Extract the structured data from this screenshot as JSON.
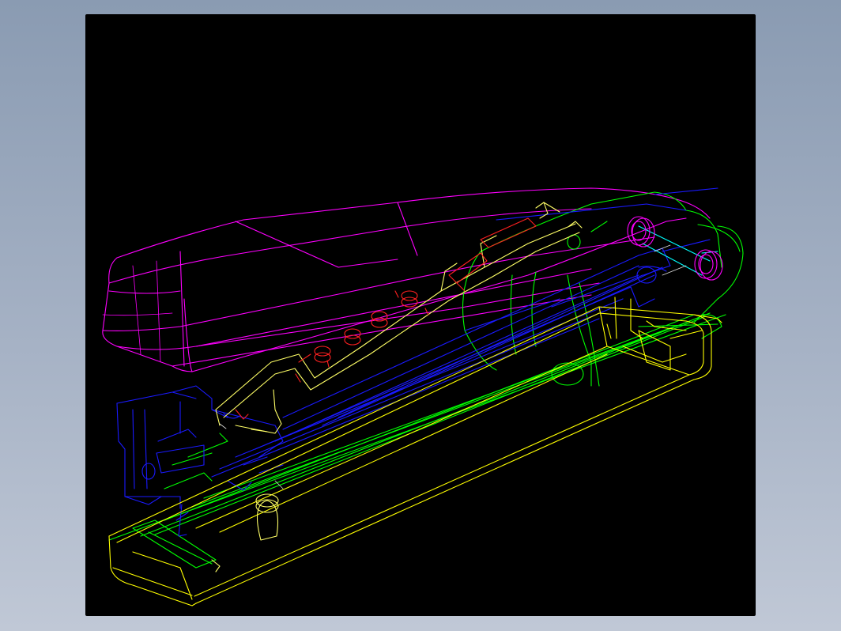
{
  "app": {
    "background_top": "#8a9bb2",
    "background_bottom": "#c0c8d6",
    "viewport_background": "#000000"
  },
  "model": {
    "view": "wireframe",
    "subject": "stapler-assembly",
    "layer_colors": {
      "handle": "#ff00ff",
      "base": "#ffff00",
      "spring_channel": "#00ff00",
      "magazine_rail": "#0000ff",
      "pusher": "#ffff66",
      "pins": "#ff0000",
      "hinge_pin": "#00ffff",
      "dark_blue_body": "#1010d0"
    }
  }
}
